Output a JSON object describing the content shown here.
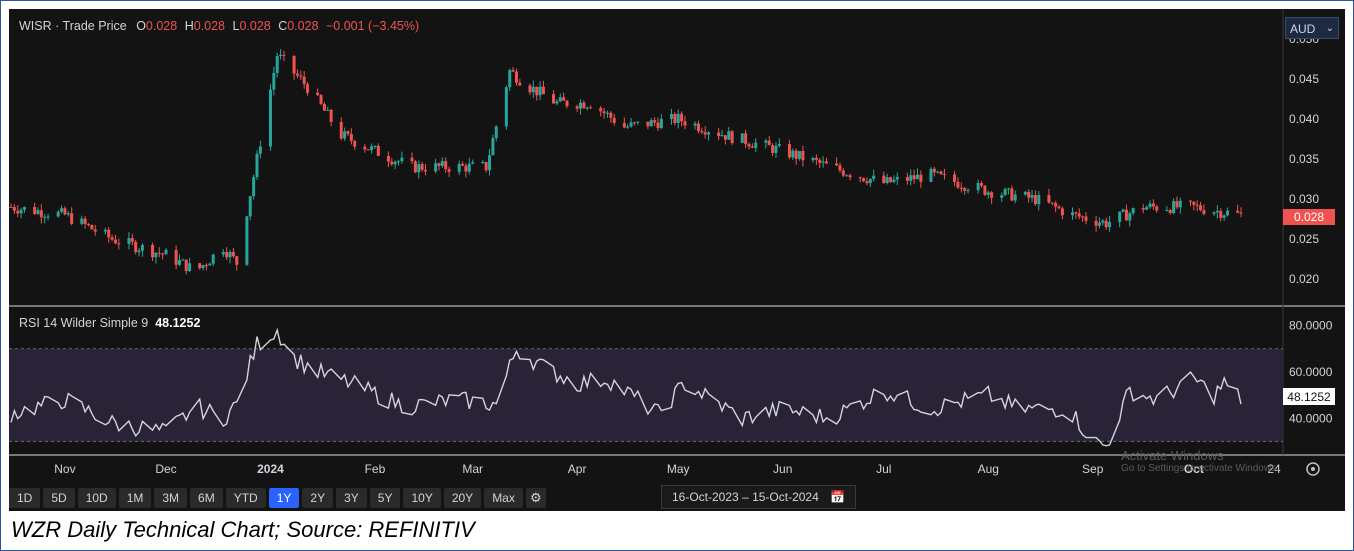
{
  "header": {
    "symbol": "WISR",
    "separator": "·",
    "subtitle": "Trade Price",
    "o_label": "O",
    "o_value": "0.028",
    "h_label": "H",
    "h_value": "0.028",
    "l_label": "L",
    "l_value": "0.028",
    "c_label": "C",
    "c_value": "0.028",
    "change": "−0.001 (−3.45%)"
  },
  "currency": {
    "value": "AUD",
    "chevron": "⌄"
  },
  "price_tag": "0.028",
  "rsi": {
    "label": "RSI 14 Wilder Simple 9",
    "value": "48.1252",
    "tag": "48.1252"
  },
  "range_buttons": [
    "1D",
    "5D",
    "10D",
    "1M",
    "3M",
    "6M",
    "YTD",
    "1Y",
    "2Y",
    "3Y",
    "5Y",
    "10Y",
    "20Y",
    "Max"
  ],
  "active_range": "1Y",
  "date_range": {
    "from": "16-Oct-2023",
    "sep": "–",
    "to": "15-Oct-2024"
  },
  "watermark": {
    "line1": "Activate Windows",
    "line2": "Go to Settings to activate Windows."
  },
  "caption": "WZR Daily Technical Chart; Source: REFINITIV",
  "colors": {
    "background": "#131313",
    "up": "#26a69a",
    "down": "#ef5350",
    "rsi_line": "#d1d4dc",
    "rsi_band": "#2a2337",
    "price_tag": "#ef5350",
    "accent": "#2962ff"
  },
  "icons": {
    "settings": "gear-icon",
    "calendar": "calendar-icon",
    "chart_settings": "settings-circle-icon"
  },
  "chart_data": [
    {
      "type": "candlestick",
      "ylim": [
        0.0175,
        0.0525
      ],
      "y_ticks": [
        "0.050",
        "0.045",
        "0.040",
        "0.035",
        "0.030",
        "0.025",
        "0.020"
      ],
      "y_tick_values": [
        0.05,
        0.045,
        0.04,
        0.035,
        0.03,
        0.025,
        0.02
      ],
      "x_ticks": [
        "Nov",
        "Dec",
        "2024",
        "Feb",
        "Mar",
        "Apr",
        "May",
        "Jun",
        "Jul",
        "Aug",
        "Sep",
        "Oct",
        "24"
      ],
      "x_tick_dates": [
        "2023-11-01",
        "2023-12-01",
        "2024-01-01",
        "2024-02-01",
        "2024-03-01",
        "2024-04-01",
        "2024-05-01",
        "2024-06-01",
        "2024-07-01",
        "2024-08-01",
        "2024-09-01",
        "2024-10-01",
        "2024-10-15"
      ],
      "anchor_dates": [
        "2023-10-16",
        "2023-11-01",
        "2023-11-15",
        "2023-12-01",
        "2023-12-10",
        "2023-12-18",
        "2023-12-22",
        "2023-12-28",
        "2024-01-03",
        "2024-01-12",
        "2024-01-22",
        "2024-02-01",
        "2024-02-12",
        "2024-02-26",
        "2024-03-05",
        "2024-03-12",
        "2024-03-18",
        "2024-03-26",
        "2024-04-05",
        "2024-04-15",
        "2024-05-01",
        "2024-05-15",
        "2024-06-01",
        "2024-06-15",
        "2024-07-01",
        "2024-07-15",
        "2024-08-01",
        "2024-08-15",
        "2024-08-26",
        "2024-09-05",
        "2024-09-16",
        "2024-10-01",
        "2024-10-15"
      ],
      "anchor_closes": [
        0.029,
        0.028,
        0.025,
        0.023,
        0.021,
        0.024,
        0.022,
        0.035,
        0.048,
        0.044,
        0.038,
        0.036,
        0.034,
        0.034,
        0.034,
        0.046,
        0.044,
        0.042,
        0.042,
        0.039,
        0.04,
        0.038,
        0.036,
        0.034,
        0.032,
        0.033,
        0.031,
        0.03,
        0.028,
        0.027,
        0.029,
        0.029,
        0.028
      ]
    },
    {
      "type": "line",
      "title": "RSI 14 Wilder Simple 9",
      "ylim": [
        25,
        85
      ],
      "y_ticks": [
        "80.0000",
        "60.0000",
        "40.0000"
      ],
      "y_tick_values": [
        80,
        60,
        40
      ],
      "bands": [
        30,
        70
      ],
      "anchor_dates": [
        "2023-10-16",
        "2023-11-01",
        "2023-11-15",
        "2023-12-01",
        "2023-12-10",
        "2023-12-18",
        "2023-12-22",
        "2023-12-28",
        "2024-01-03",
        "2024-01-08",
        "2024-01-15",
        "2024-01-25",
        "2024-02-10",
        "2024-02-25",
        "2024-03-08",
        "2024-03-14",
        "2024-03-22",
        "2024-04-01",
        "2024-04-10",
        "2024-04-25",
        "2024-05-03",
        "2024-05-20",
        "2024-06-01",
        "2024-06-15",
        "2024-07-01",
        "2024-07-15",
        "2024-08-01",
        "2024-08-10",
        "2024-08-25",
        "2024-09-01",
        "2024-09-05",
        "2024-09-12",
        "2024-09-20",
        "2024-10-01",
        "2024-10-07",
        "2024-10-10",
        "2024-10-15"
      ],
      "anchor_values": [
        42,
        48,
        38,
        34,
        45,
        40,
        46,
        72,
        78,
        66,
        60,
        55,
        45,
        48,
        46,
        70,
        62,
        55,
        57,
        42,
        55,
        40,
        44,
        40,
        52,
        44,
        50,
        44,
        44,
        30,
        28,
        52,
        48,
        57,
        50,
        55,
        48.1252
      ]
    }
  ]
}
